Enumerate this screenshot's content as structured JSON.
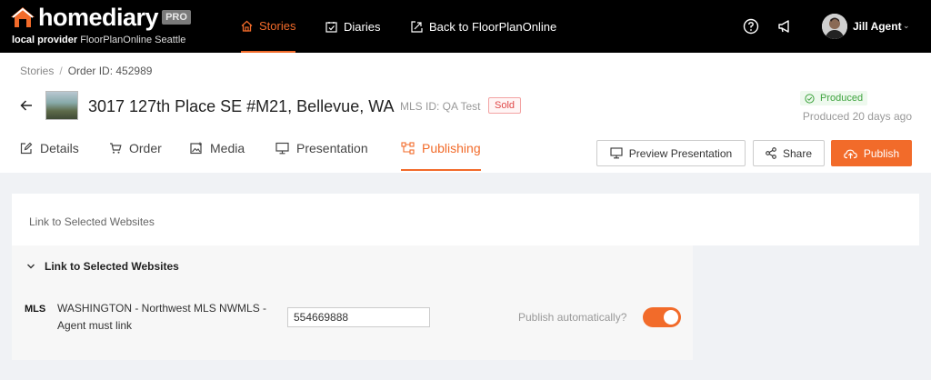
{
  "app": {
    "logo_home": "home",
    "logo_diary": "diary",
    "logo_pro": "PRO",
    "provider_label": "local provider",
    "provider_name": "FloorPlanOnline Seattle"
  },
  "nav": {
    "stories": "Stories",
    "diaries": "Diaries",
    "back": "Back to FloorPlanOnline"
  },
  "user": {
    "name": "Jill Agent"
  },
  "breadcrumb": {
    "root": "Stories",
    "separator": "/",
    "current": "Order ID: 452989"
  },
  "listing": {
    "address": "3017 127th Place SE #M21, Bellevue, WA",
    "mls_id": "MLS ID: QA Test",
    "status": "Sold",
    "produced_label": "Produced",
    "produced_ago": "Produced 20 days ago"
  },
  "tabs": {
    "details": "Details",
    "order": "Order",
    "media": "Media",
    "presentation": "Presentation",
    "publishing": "Publishing"
  },
  "buttons": {
    "preview": "Preview Presentation",
    "share": "Share",
    "publish": "Publish"
  },
  "content": {
    "panel_title": "Link to Selected Websites",
    "section_title": "Link to Selected Websites",
    "mls_logo": "MLS",
    "mls_name": "WASHINGTON - Northwest MLS NWMLS - Agent must link",
    "mls_value": "554669888",
    "auto_label": "Publish automatically?",
    "auto_enabled": true
  },
  "colors": {
    "accent": "#f26b2a",
    "topbar": "#000000",
    "success": "#3ea33e",
    "danger": "#e04848"
  }
}
